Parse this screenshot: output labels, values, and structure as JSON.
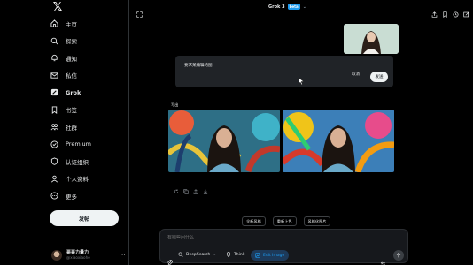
{
  "sidebar": {
    "items": [
      {
        "label": "主页",
        "icon": "home-icon"
      },
      {
        "label": "探索",
        "icon": "search-icon"
      },
      {
        "label": "通知",
        "icon": "bell-icon"
      },
      {
        "label": "私信",
        "icon": "mail-icon"
      },
      {
        "label": "Grok",
        "icon": "grok-icon"
      },
      {
        "label": "书签",
        "icon": "bookmark-icon"
      },
      {
        "label": "社群",
        "icon": "communities-icon"
      },
      {
        "label": "Premium",
        "icon": "premium-icon"
      },
      {
        "label": "认证组织",
        "icon": "verified-orgs-icon"
      },
      {
        "label": "个人资料",
        "icon": "profile-icon"
      },
      {
        "label": "更多",
        "icon": "more-icon"
      }
    ],
    "post_label": "发帖",
    "profile": {
      "name": "哥哥力量力",
      "handle": "@xiaoxiaohe",
      "more": "···"
    }
  },
  "header": {
    "title": "Grok 3",
    "badge": "beta"
  },
  "dialog": {
    "placeholder": "要求某编辑的图",
    "cancel": "取消",
    "send": "发送"
  },
  "response": {
    "label": "写出"
  },
  "chips": [
    "全新风格",
    "重新上色",
    "风格化图片"
  ],
  "composer": {
    "placeholder": "有哪些问什么",
    "deepsearch": "DeepSearch",
    "think": "Think",
    "edit_image": "Edit Image"
  },
  "colors": {
    "background": "#000000",
    "accent": "#1d9bf0",
    "surface": "#202327"
  }
}
